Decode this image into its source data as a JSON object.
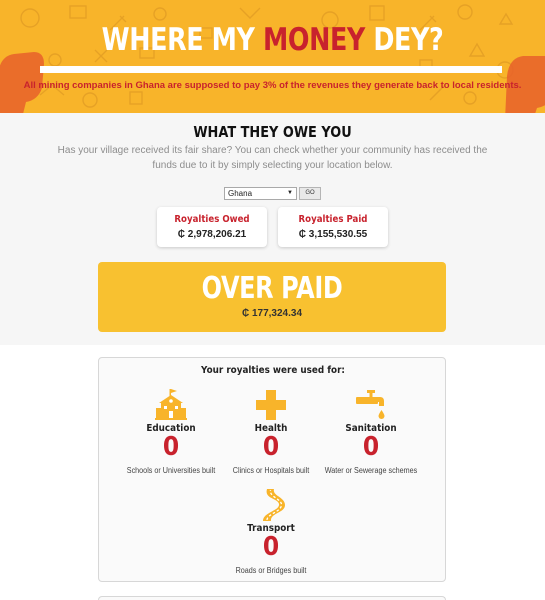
{
  "header": {
    "title_part1": "WHERE MY ",
    "title_money": "MONEY",
    "title_part2": " DEY?",
    "subtitle": "All mining companies in Ghana are supposed to pay 3% of the revenues they generate back to local residents."
  },
  "owe": {
    "title": "WHAT THEY OWE YOU",
    "description": "Has your village received its fair share? You can check whether your community has received the funds due to it by simply selecting your location below.",
    "location_select": "Ghana",
    "go_label": "GO"
  },
  "royalties": {
    "owed_label": "Royalties Owed",
    "owed_value": "₵ 2,978,206.21",
    "paid_label": "Royalties Paid",
    "paid_value": "₵ 3,155,530.55"
  },
  "status": {
    "label": "OVER PAID",
    "amount": "₵ 177,324.34"
  },
  "usage": {
    "title": "Your royalties were used for:",
    "items": [
      {
        "name": "Education",
        "count": "0",
        "desc": "Schools or Universities built",
        "icon": "school-icon"
      },
      {
        "name": "Health",
        "count": "0",
        "desc": "Clinics or Hospitals built",
        "icon": "health-cross-icon"
      },
      {
        "name": "Sanitation",
        "count": "0",
        "desc": "Water or Sewerage schemes",
        "icon": "faucet-icon"
      },
      {
        "name": "Transport",
        "count": "0",
        "desc": "Roads or Bridges built",
        "icon": "road-icon"
      }
    ]
  },
  "colors": {
    "accent_yellow": "#f8b42a",
    "status_yellow": "#f8c130",
    "brand_red": "#c8222d"
  }
}
